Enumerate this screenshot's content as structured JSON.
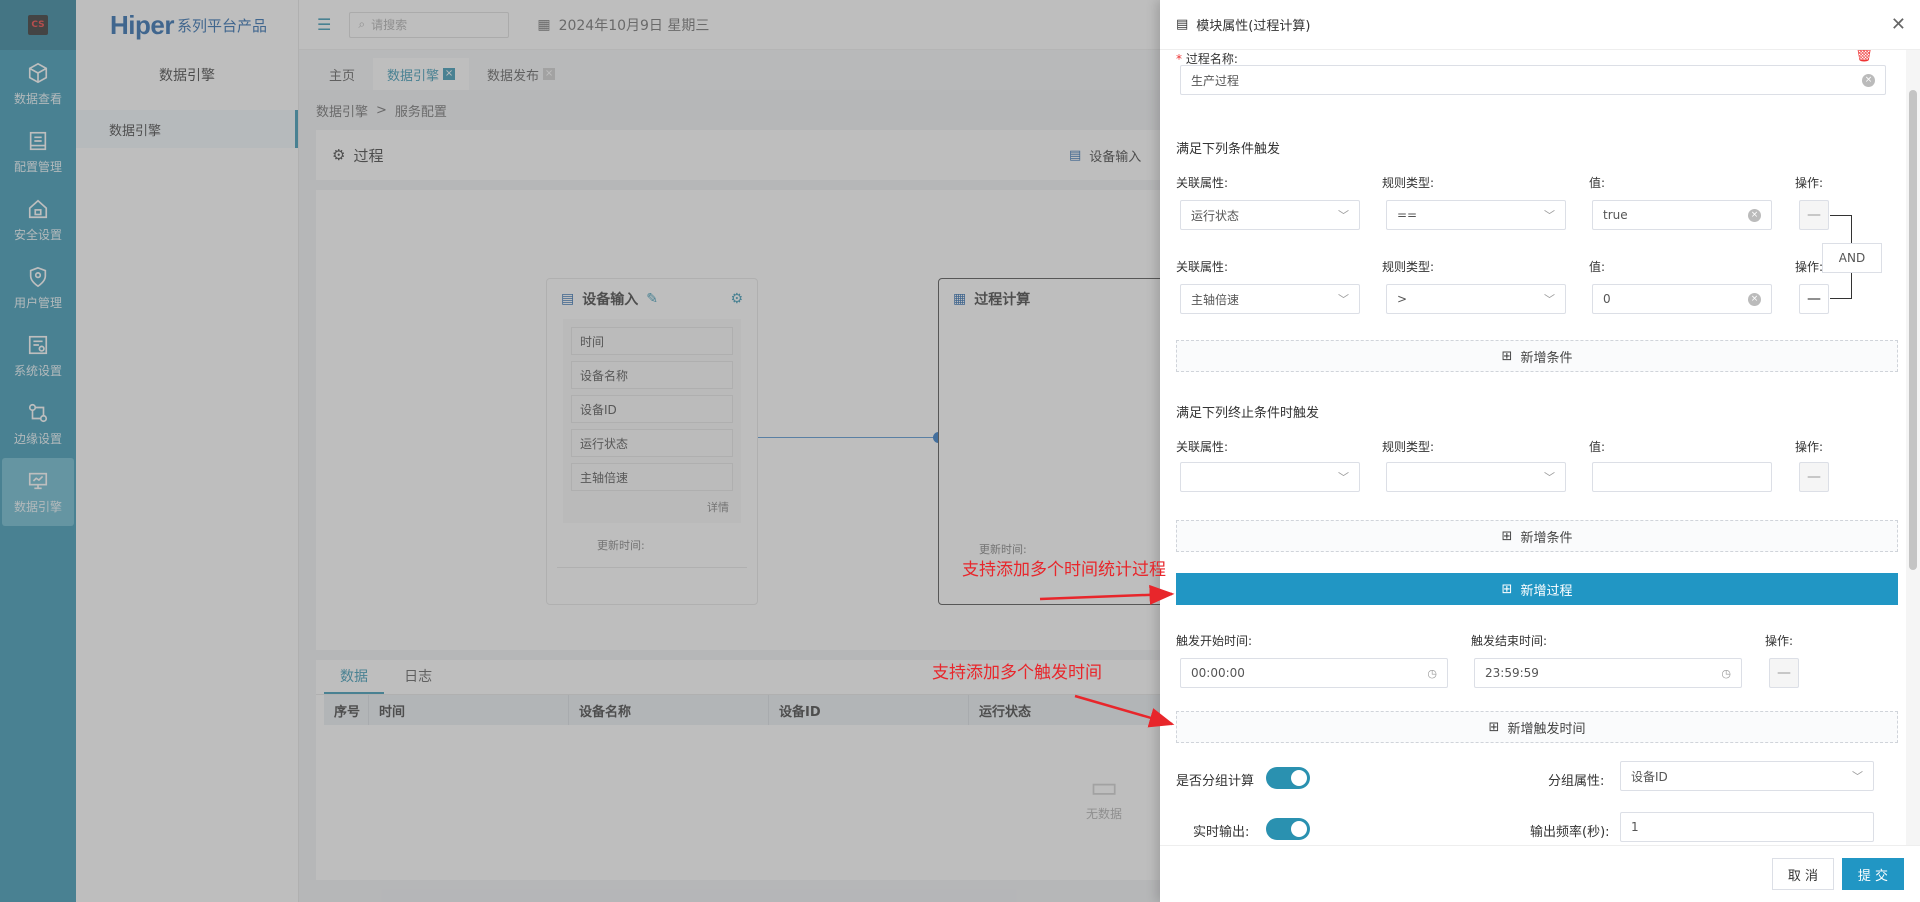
{
  "rail": {
    "logo": "CS",
    "items": [
      {
        "label": "数据查看",
        "icon": "cube-icon"
      },
      {
        "label": "配置管理",
        "icon": "config-icon"
      },
      {
        "label": "安全设置",
        "icon": "home-lock-icon"
      },
      {
        "label": "用户管理",
        "icon": "shield-user-icon"
      },
      {
        "label": "系统设置",
        "icon": "system-settings-icon"
      },
      {
        "label": "边缘设置",
        "icon": "edge-icon"
      },
      {
        "label": "数据引擎",
        "icon": "data-engine-icon"
      }
    ]
  },
  "sidebar": {
    "brand_main": "Hiper",
    "brand_sub": "系列平台产品",
    "title": "数据引擎",
    "items": [
      {
        "label": "数据引擎"
      }
    ]
  },
  "topbar": {
    "search_placeholder": "请搜索",
    "date": "2024年10月9日 星期三"
  },
  "tabs": [
    {
      "label": "主页"
    },
    {
      "label": "数据引擎"
    },
    {
      "label": "数据发布"
    }
  ],
  "breadcrumb": {
    "root": "数据引擎",
    "sep": ">",
    "current": "服务配置"
  },
  "process": {
    "title": "过程",
    "device_input_button": "设备输入"
  },
  "node_input": {
    "title": "设备输入",
    "fields": [
      "时间",
      "设备名称",
      "设备ID",
      "运行状态",
      "主轴倍速"
    ],
    "detail": "详情",
    "update_time": "更新时间:"
  },
  "node_calc": {
    "title": "过程计算",
    "update_time": "更新时间:"
  },
  "bottom": {
    "tabs": [
      "数据",
      "日志"
    ],
    "columns": [
      "序号",
      "时间",
      "设备名称",
      "设备ID",
      "运行状态"
    ],
    "empty": "无数据"
  },
  "drawer": {
    "title": "模块属性(过程计算)",
    "process_name_label": "过程名称:",
    "required_mark": "*",
    "process_name_value": "生产过程",
    "trigger_section": "满足下列条件触发",
    "col_attr": "关联属性:",
    "col_rule": "规则类型:",
    "col_value": "值:",
    "col_op": "操作:",
    "trigger_rows": [
      {
        "attr": "运行状态",
        "rule": "==",
        "value": "true"
      },
      {
        "attr": "主轴倍速",
        "rule": ">",
        "value": "0"
      }
    ],
    "and_label": "AND",
    "add_condition": "新增条件",
    "end_section": "满足下列终止条件时触发",
    "add_process": "新增过程",
    "trigger_start_label": "触发开始时间:",
    "trigger_end_label": "触发结束时间:",
    "trigger_start_value": "00:00:00",
    "trigger_end_value": "23:59:59",
    "add_trigger_time": "新增触发时间",
    "group_calc_label": "是否分组计算",
    "group_attr_label": "分组属性:",
    "group_attr_value": "设备ID",
    "realtime_label": "实时输出:",
    "freq_label": "输出频率(秒):",
    "freq_value": "1",
    "cancel": "取 消",
    "submit": "提 交"
  },
  "annotations": {
    "a1": "支持添加多个时间统计过程",
    "a2": "支持添加多个触发时间"
  },
  "colors": {
    "accent": "#2a91b0",
    "primary": "#2196c4",
    "annotation": "#e8262b"
  }
}
